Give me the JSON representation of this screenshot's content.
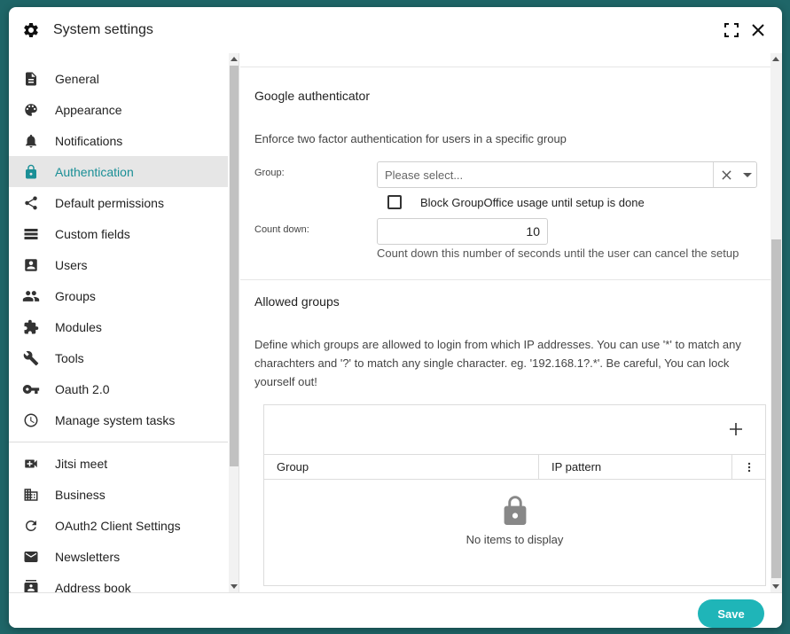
{
  "window": {
    "title": "System settings"
  },
  "sidebar": {
    "items": [
      {
        "label": "General",
        "icon": "document-icon"
      },
      {
        "label": "Appearance",
        "icon": "palette-icon"
      },
      {
        "label": "Notifications",
        "icon": "bell-icon"
      },
      {
        "label": "Authentication",
        "icon": "lock-icon",
        "active": true
      },
      {
        "label": "Default permissions",
        "icon": "share-icon"
      },
      {
        "label": "Custom fields",
        "icon": "list-icon"
      },
      {
        "label": "Users",
        "icon": "user-box-icon"
      },
      {
        "label": "Groups",
        "icon": "people-icon"
      },
      {
        "label": "Modules",
        "icon": "puzzle-icon"
      },
      {
        "label": "Tools",
        "icon": "wrench-icon"
      },
      {
        "label": "Oauth 2.0",
        "icon": "key-icon"
      },
      {
        "label": "Manage system tasks",
        "icon": "clock-icon"
      }
    ],
    "module_items": [
      {
        "label": "Jitsi meet",
        "icon": "video-add-icon"
      },
      {
        "label": "Business",
        "icon": "building-icon"
      },
      {
        "label": "OAuth2 Client Settings",
        "icon": "refresh-icon"
      },
      {
        "label": "Newsletters",
        "icon": "mail-icon"
      },
      {
        "label": "Address book",
        "icon": "contacts-icon"
      }
    ]
  },
  "google_auth": {
    "title": "Google authenticator",
    "description": "Enforce two factor authentication for users in a specific group",
    "group_label": "Group:",
    "group_placeholder": "Please select...",
    "block_label": "Block GroupOffice usage until setup is done",
    "countdown_label": "Count down:",
    "countdown_value": "10",
    "countdown_hint": "Count down this number of seconds until the user can cancel the setup"
  },
  "allowed_groups": {
    "title": "Allowed groups",
    "description_line1": "Define which groups are allowed to login from which IP addresses. You can use '*' to match any",
    "description_line2": "charachters and '?' to match any single character. eg. '192.168.1?.*'. Be careful, You can lock",
    "description_line3": "yourself out!",
    "columns": [
      "Group",
      "IP pattern"
    ],
    "empty_message": "No items to display"
  },
  "footer": {
    "save_label": "Save"
  },
  "colors": {
    "accent": "#1fb5b8",
    "active_text": "#1a8f96",
    "background": "#1f6668"
  }
}
